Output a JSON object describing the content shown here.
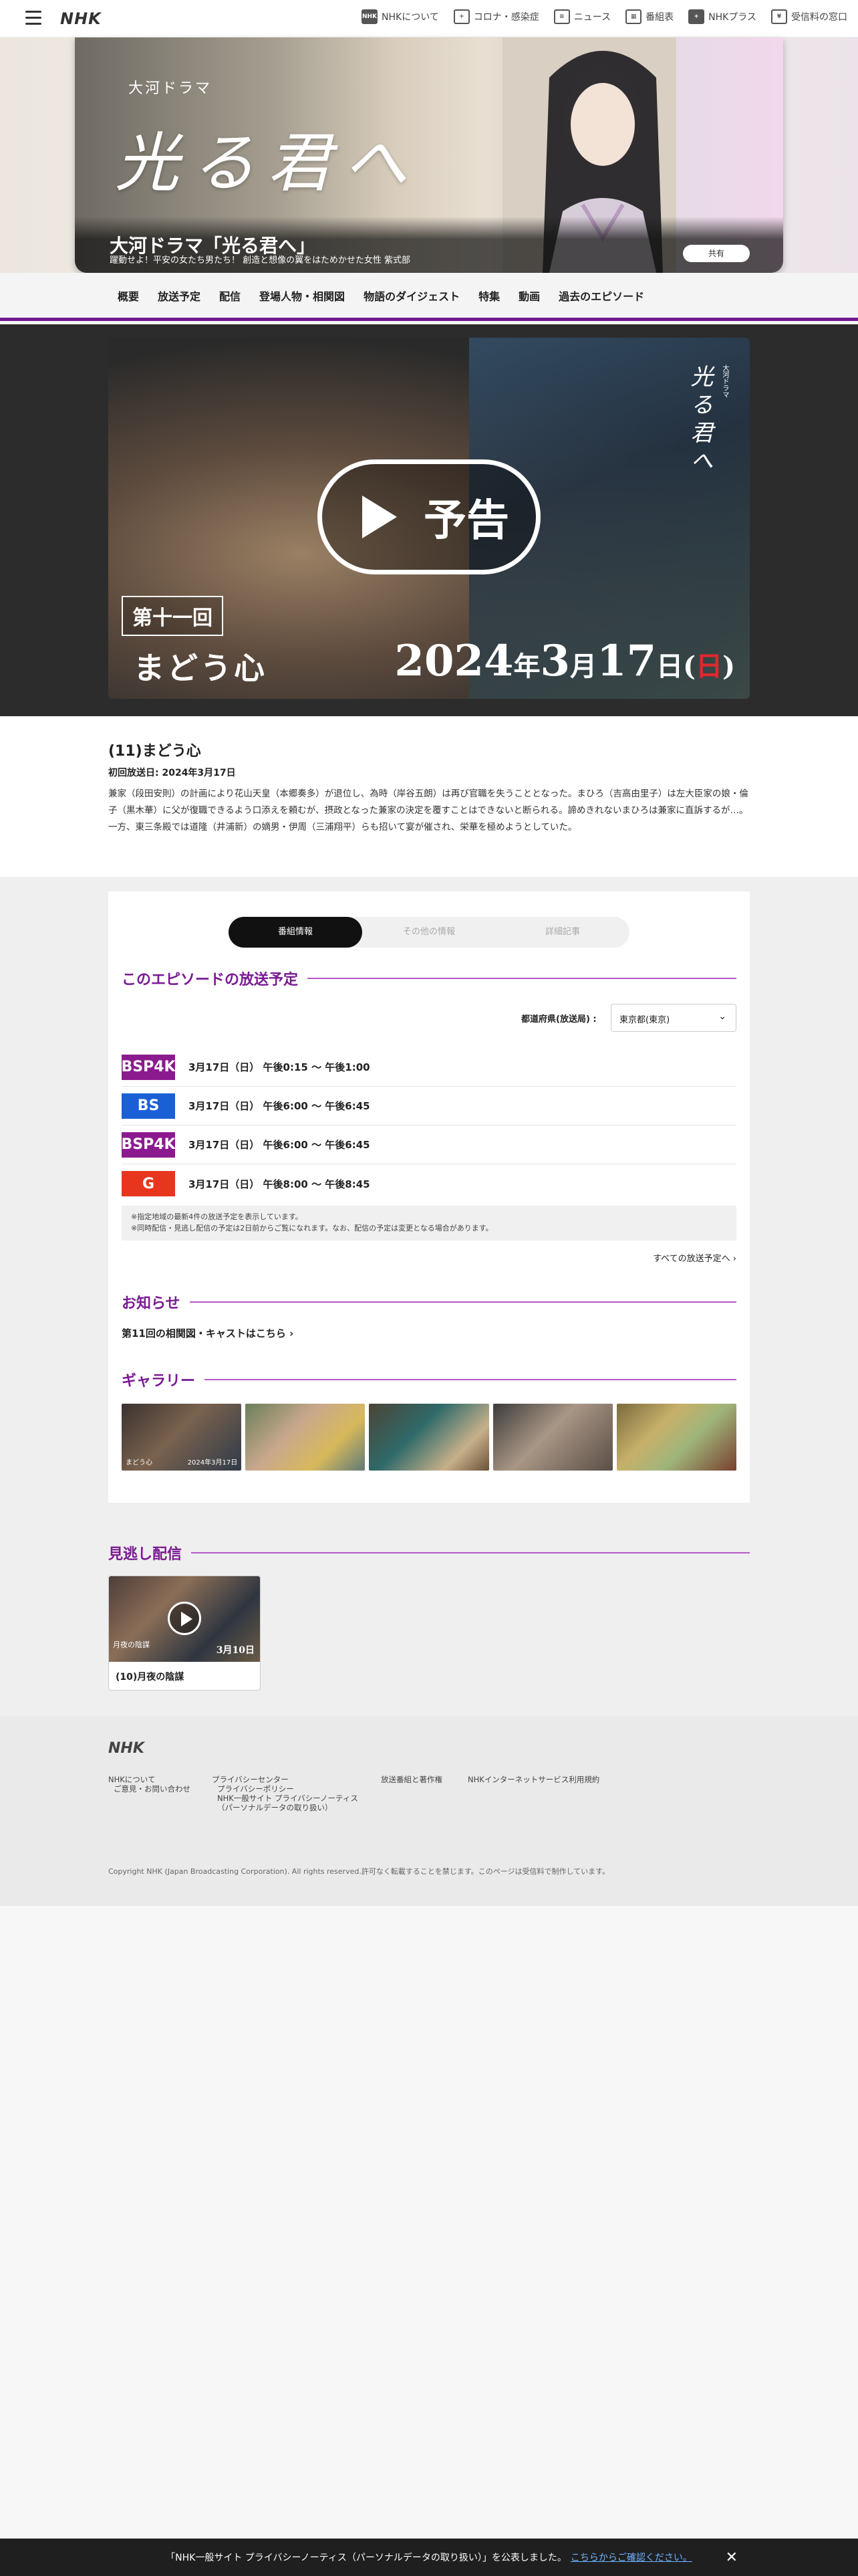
{
  "topbar": {
    "logo": "NHK",
    "nav": [
      {
        "label": "NHKについて",
        "icon": "NHK"
      },
      {
        "label": "コロナ・感染症",
        "icon": "+"
      },
      {
        "label": "ニュース",
        "icon": "≡"
      },
      {
        "label": "番組表",
        "icon": "▦"
      },
      {
        "label": "NHKプラス",
        "icon": "+"
      },
      {
        "label": "受信料の窓口",
        "icon": "¥"
      }
    ]
  },
  "hero": {
    "small_title": "大河ドラマ",
    "calligraphy": "光る君へ",
    "title": "大河ドラマ「光る君へ」",
    "subtitle": "躍動せよ！平安の女たち男たち！ 創造と想像の翼をはためかせた女性 紫式部",
    "share_label": "共有"
  },
  "mainnav": [
    "概要",
    "放送予定",
    "配信",
    "登場人物・相関図",
    "物語のダイジェスト",
    "特集",
    "動画",
    "過去のエピソード"
  ],
  "video": {
    "play_label": "予告",
    "episode_box": "第十一回",
    "episode_title": "まどう心",
    "date_year": "2024",
    "date_year_unit": "年",
    "date_month": "3",
    "date_month_unit": "月",
    "date_day": "17",
    "date_day_unit": "日",
    "date_open": "(",
    "date_weekday": "日",
    "date_close": ")",
    "calligraphy": "光る君へ",
    "calligraphy_small": "大河ドラマ"
  },
  "episode": {
    "title": "(11)まどう心",
    "first_broadcast": "初回放送日: 2024年3月17日",
    "description": "兼家（段田安則）の計画により花山天皇（本郷奏多）が退位し、為時（岸谷五朗）は再び官職を失うこととなった。まひろ（吉高由里子）は左大臣家の娘・倫子（黒木華）に父が復職できるよう口添えを頼むが、摂政となった兼家の決定を覆すことはできないと断られる。諦めきれないまひろは兼家に直訴するが…。一方、東三条殿では道隆（井浦新）の嫡男・伊周（三浦翔平）らも招いて宴が催され、栄華を極めようとしていた。"
  },
  "tabs": [
    "番組情報",
    "その他の情報",
    "詳細記事"
  ],
  "schedule": {
    "heading": "このエピソードの放送予定",
    "pref_label": "都道府県(放送局) :",
    "pref_value": "東京都(東京)",
    "rows": [
      {
        "badge": "BSP4K",
        "color": "#8c1a8f",
        "text": "3月17日（日） 午後0:15 〜 午後1:00"
      },
      {
        "badge": "BS",
        "color": "#1a5fd6",
        "text": "3月17日（日） 午後6:00 〜 午後6:45"
      },
      {
        "badge": "BSP4K",
        "color": "#8c1a8f",
        "text": "3月17日（日） 午後6:00 〜 午後6:45"
      },
      {
        "badge": "G",
        "color": "#e8361e",
        "text": "3月17日（日） 午後8:00 〜 午後8:45"
      }
    ],
    "note1": "※指定地域の最新4件の放送予定を表示しています。",
    "note2": "※同時配信・見逃し配信の予定は2日前からご覧になれます。なお、配信の予定は変更となる場合があります。",
    "all_link": "すべての放送予定へ"
  },
  "news": {
    "heading": "お知らせ",
    "link": "第11回の相関図・キャストはこちら"
  },
  "gallery": {
    "heading": "ギャラリー",
    "thumb_caption": "まどう心",
    "thumb_date": "2024年3月17日"
  },
  "catchup": {
    "heading": "見逃し配信",
    "item_title": "(10)月夜の陰謀",
    "img_episode": "月夜の陰謀",
    "img_date": "3月10日"
  },
  "footer": {
    "logo": "NHK",
    "col1": [
      "NHKについて",
      "ご意見・お問い合わせ"
    ],
    "col2": [
      "プライバシーセンター",
      "プライバシーポリシー",
      "NHK一般サイト プライバシーノーティス",
      "（パーソナルデータの取り扱い）"
    ],
    "col3": [
      "放送番組と著作権"
    ],
    "col4": [
      "NHKインターネットサービス利用規約"
    ],
    "copyright": "Copyright NHK (Japan Broadcasting Corporation). All rights reserved.許可なく転載することを禁じます。このページは受信料で制作しています。"
  },
  "notice": {
    "text": "「NHK一般サイト プライバシーノーティス（パーソナルデータの取り扱い）」を公表しました。",
    "link": "こちらからご確認ください。"
  },
  "colors": {
    "brand_purple": "#7a1a93",
    "sunday_red": "#e0282d"
  }
}
